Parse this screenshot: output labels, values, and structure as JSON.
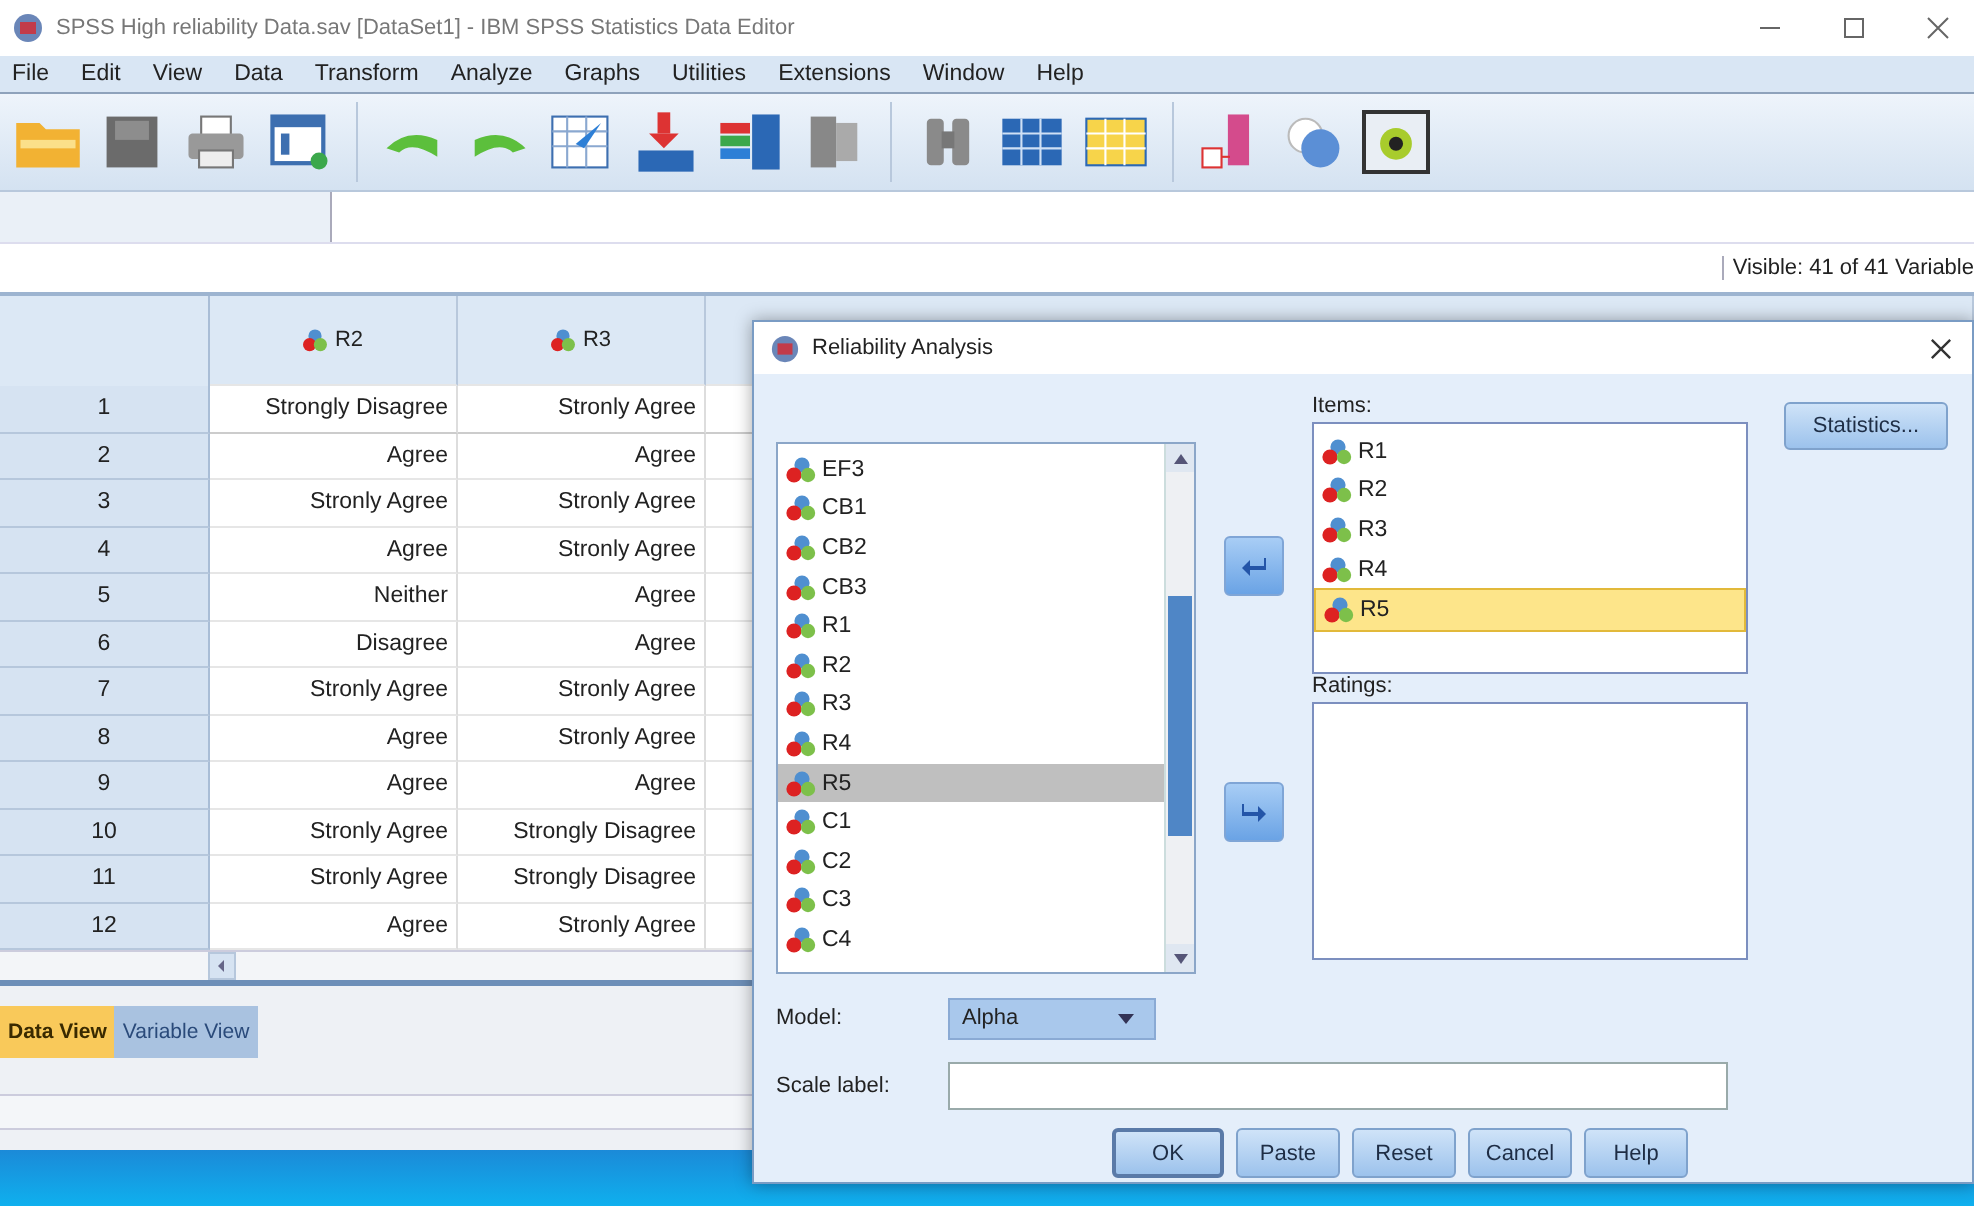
{
  "window": {
    "title": "SPSS High reliability Data.sav [DataSet1] - IBM SPSS Statistics Data Editor"
  },
  "menu": [
    "File",
    "Edit",
    "View",
    "Data",
    "Transform",
    "Analyze",
    "Graphs",
    "Utilities",
    "Extensions",
    "Window",
    "Help"
  ],
  "visible_label": "Visible: 41 of 41 Variable",
  "grid": {
    "columns": [
      "R2",
      "R3"
    ],
    "rows": [
      {
        "number": "1",
        "cells": [
          "Strongly Disagree",
          "Stronly Agree"
        ]
      },
      {
        "number": "2",
        "cells": [
          "Agree",
          "Agree"
        ]
      },
      {
        "number": "3",
        "cells": [
          "Stronly Agree",
          "Stronly Agree"
        ]
      },
      {
        "number": "4",
        "cells": [
          "Agree",
          "Stronly Agree"
        ]
      },
      {
        "number": "5",
        "cells": [
          "Neither",
          "Agree"
        ]
      },
      {
        "number": "6",
        "cells": [
          "Disagree",
          "Agree"
        ]
      },
      {
        "number": "7",
        "cells": [
          "Stronly Agree",
          "Stronly Agree"
        ]
      },
      {
        "number": "8",
        "cells": [
          "Agree",
          "Stronly Agree"
        ]
      },
      {
        "number": "9",
        "cells": [
          "Agree",
          "Agree"
        ]
      },
      {
        "number": "10",
        "cells": [
          "Stronly Agree",
          "Strongly Disagree"
        ]
      },
      {
        "number": "11",
        "cells": [
          "Stronly Agree",
          "Strongly Disagree"
        ]
      },
      {
        "number": "12",
        "cells": [
          "Agree",
          "Stronly Agree"
        ]
      }
    ]
  },
  "tabs": [
    {
      "label": "Data View",
      "selected": true
    },
    {
      "label": "Variable View",
      "selected": false
    }
  ],
  "dialog": {
    "title": "Reliability Analysis",
    "variables": [
      {
        "name": "EF3",
        "selected": false
      },
      {
        "name": "CB1",
        "selected": false
      },
      {
        "name": "CB2",
        "selected": false
      },
      {
        "name": "CB3",
        "selected": false
      },
      {
        "name": "R1",
        "selected": false
      },
      {
        "name": "R2",
        "selected": false
      },
      {
        "name": "R3",
        "selected": false
      },
      {
        "name": "R4",
        "selected": false
      },
      {
        "name": "R5",
        "selected": true
      },
      {
        "name": "C1",
        "selected": false
      },
      {
        "name": "C2",
        "selected": false
      },
      {
        "name": "C3",
        "selected": false
      },
      {
        "name": "C4",
        "selected": false
      }
    ],
    "items_label": "Items:",
    "items": [
      {
        "name": "R1",
        "selected": false
      },
      {
        "name": "R2",
        "selected": false
      },
      {
        "name": "R3",
        "selected": false
      },
      {
        "name": "R4",
        "selected": false
      },
      {
        "name": "R5",
        "selected": true
      }
    ],
    "ratings_label": "Ratings:",
    "statistics_button": "Statistics...",
    "model_label": "Model:",
    "model_value": "Alpha",
    "scale_label": "Scale label:",
    "buttons": [
      "OK",
      "Paste",
      "Reset",
      "Cancel",
      "Help"
    ]
  }
}
